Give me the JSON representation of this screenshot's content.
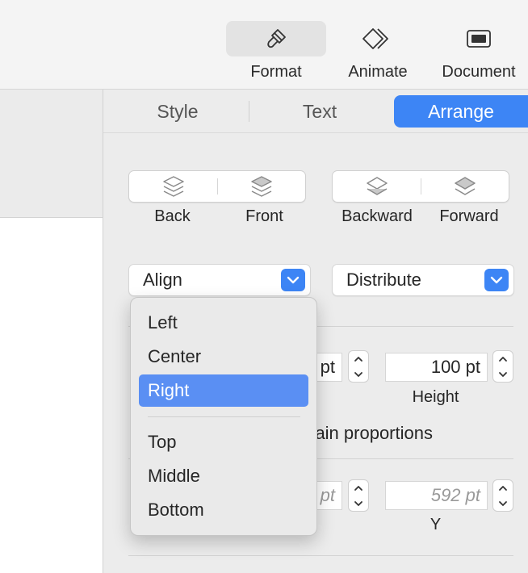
{
  "toolbar": {
    "buttons": [
      {
        "label": "Format",
        "icon": "paintbrush-icon",
        "active": true
      },
      {
        "label": "Animate",
        "icon": "diamond-icon",
        "active": false
      },
      {
        "label": "Document",
        "icon": "document-icon",
        "active": false
      }
    ]
  },
  "inspector": {
    "tabs": [
      {
        "label": "Style"
      },
      {
        "label": "Text"
      },
      {
        "label": "Arrange",
        "active": true
      }
    ],
    "layering": {
      "back_label": "Back",
      "front_label": "Front",
      "backward_label": "Backward",
      "forward_label": "Forward"
    },
    "align_popup": {
      "label": "Align"
    },
    "distribute_popup": {
      "label": "Distribute"
    },
    "size": {
      "width_value_partial": "pt",
      "height_value": "100 pt",
      "height_label": "Height",
      "constrain_partial": "strain proportions"
    },
    "position": {
      "x_value_partial": "pt",
      "y_value": "592 pt",
      "y_label": "Y"
    }
  },
  "align_menu": {
    "items": [
      "Left",
      "Center",
      "Right"
    ],
    "items2": [
      "Top",
      "Middle",
      "Bottom"
    ],
    "selected": "Right"
  },
  "colors": {
    "accent": "#3d85f5",
    "menu_highlight": "#5a8ff3"
  }
}
